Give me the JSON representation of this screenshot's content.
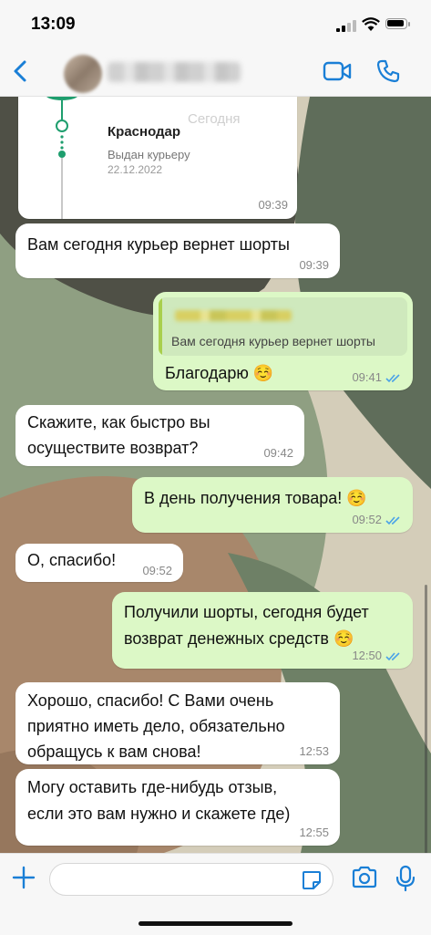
{
  "status_bar": {
    "time": "13:09"
  },
  "header": {
    "contact_name_redacted": true
  },
  "colors": {
    "accent": "#1a7fd6",
    "outgoing_bubble": "#dcf8c6",
    "incoming_bubble": "#ffffff",
    "read_ticks": "#4aa2e8"
  },
  "tracking_card": {
    "city": "Краснодар",
    "today": "Сегодня",
    "status": "Выдан курьеру",
    "date": "22.12.2022",
    "time": "09:39"
  },
  "messages": [
    {
      "dir": "in",
      "text": "Вам сегодня курьер вернет шорты",
      "time": "09:39"
    },
    {
      "dir": "out",
      "quote": "Вам сегодня курьер вернет шорты",
      "text": "Благодарю ☺️",
      "time": "09:41",
      "read": true
    },
    {
      "dir": "in",
      "text": "Скажите, как быстро вы\nосуществите возврат?",
      "time": "09:42"
    },
    {
      "dir": "out",
      "text": "В день получения товара! ☺️",
      "time": "09:52",
      "read": true
    },
    {
      "dir": "in",
      "text": "О, спасибо!",
      "time": "09:52"
    },
    {
      "dir": "out",
      "text": "Получили шорты, сегодня будет\nвозврат денежных средств ☺️",
      "time": "12:50",
      "read": true
    },
    {
      "dir": "in",
      "text": "Хорошо, спасибо! С Вами очень\nприятно иметь дело, обязательно\nобращусь к вам снова!",
      "time": "12:53"
    },
    {
      "dir": "in",
      "text": "Могу оставить где-нибудь отзыв,\nесли это вам нужно и скажете где)",
      "time": "12:55"
    }
  ],
  "icons": {
    "back": "chevron-left-icon",
    "video": "video-call-icon",
    "call": "phone-icon",
    "plus": "plus-icon",
    "sticker": "sticker-icon",
    "camera": "camera-icon",
    "mic": "microphone-icon"
  }
}
